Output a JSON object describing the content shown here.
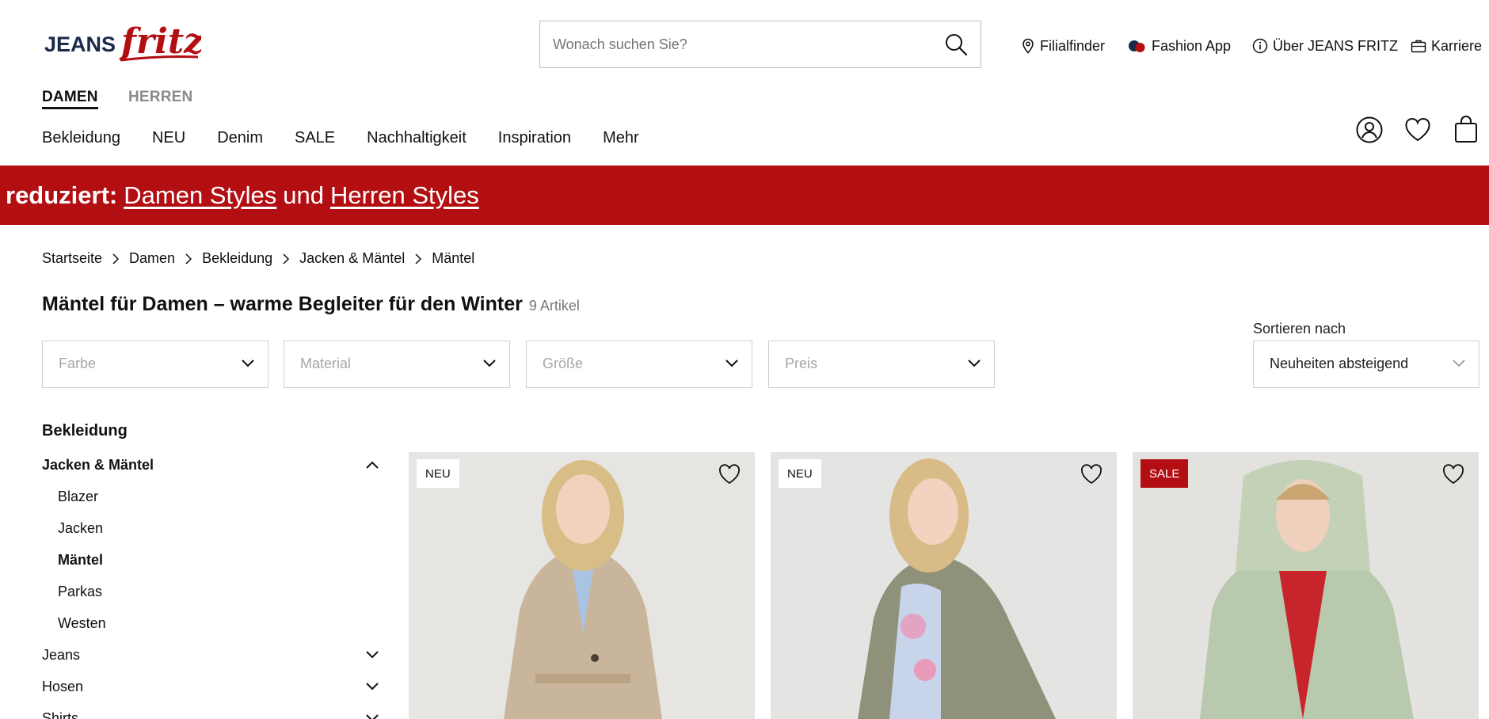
{
  "header": {
    "logo_text": "JEANS fritz",
    "search_placeholder": "Wonach suchen Sie?",
    "links": [
      {
        "label": "Filialfinder",
        "icon": "location-pin-icon"
      },
      {
        "label": "Fashion App",
        "icon": "app-dots-icon"
      },
      {
        "label": "Über JEANS FRITZ",
        "icon": "info-icon"
      },
      {
        "label": "Karriere",
        "icon": "briefcase-icon"
      }
    ]
  },
  "gender_tabs": {
    "women": "DAMEN",
    "men": "HERREN"
  },
  "main_nav": [
    "Bekleidung",
    "NEU",
    "Denim",
    "SALE",
    "Nachhaltigkeit",
    "Inspiration",
    "Mehr"
  ],
  "banner": {
    "prefix": "reduziert:",
    "link1": "Damen Styles",
    "middle": "und",
    "link2": "Herren Styles",
    "color": "#b30f13"
  },
  "breadcrumb": [
    "Startseite",
    "Damen",
    "Bekleidung",
    "Jacken & Mäntel",
    "Mäntel"
  ],
  "page": {
    "title": "Mäntel für Damen – warme Begleiter für den Winter",
    "count": "9 Artikel"
  },
  "filters": [
    "Farbe",
    "Material",
    "Größe",
    "Preis"
  ],
  "sort": {
    "label": "Sortieren nach",
    "value": "Neuheiten absteigend"
  },
  "sidebar": {
    "title": "Bekleidung",
    "category": "Jacken & Mäntel",
    "subcategories": [
      "Blazer",
      "Jacken",
      "Mäntel",
      "Parkas",
      "Westen"
    ],
    "active_subcategory": "Mäntel",
    "other_categories": [
      "Jeans",
      "Hosen",
      "Shirts"
    ]
  },
  "products": [
    {
      "badge": "NEU",
      "badge_type": "neu",
      "garment_color": "#c9b59b"
    },
    {
      "badge": "NEU",
      "badge_type": "neu",
      "garment_color": "#8f917a"
    },
    {
      "badge": "SALE",
      "badge_type": "sale",
      "garment_color": "#b9c9ad"
    }
  ]
}
